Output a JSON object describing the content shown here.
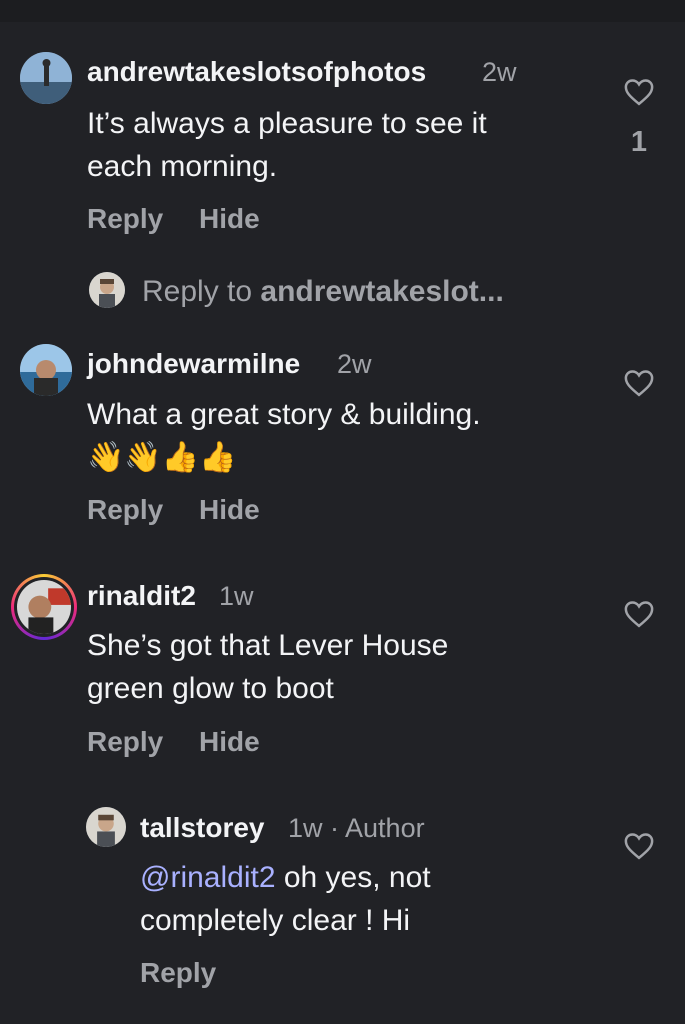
{
  "comments": [
    {
      "username": "andrewtakeslotsofphotos",
      "age": "2w",
      "text_line1": "It’s always a pleasure to see it",
      "text_line2": "each morning.",
      "reply_label": "Reply",
      "hide_label": "Hide",
      "like_count": "1"
    },
    {
      "username": "johndewarmilne",
      "age": "2w",
      "text_line1": "What a great story & building.",
      "emoji_line": "👋👋👍👍",
      "reply_label": "Reply",
      "hide_label": "Hide"
    },
    {
      "username": "rinaldit2",
      "age": "1w",
      "text_line1": "She’s got that Lever House",
      "text_line2": "green glow to boot",
      "reply_label": "Reply",
      "hide_label": "Hide"
    }
  ],
  "reply_composer": {
    "prefix": "Reply to ",
    "target": "andrewtakeslot..."
  },
  "author_reply": {
    "username": "tallstorey",
    "age": "1w",
    "separator": " · ",
    "badge": "Author",
    "mention": "@rinaldit2",
    "text_line1_rest": " oh yes, not",
    "text_line2": "completely clear ! Hi",
    "reply_label": "Reply"
  },
  "colors": {
    "background": "#212226",
    "secondary_text": "#a1a3a8",
    "mention": "#a9b1ff"
  }
}
